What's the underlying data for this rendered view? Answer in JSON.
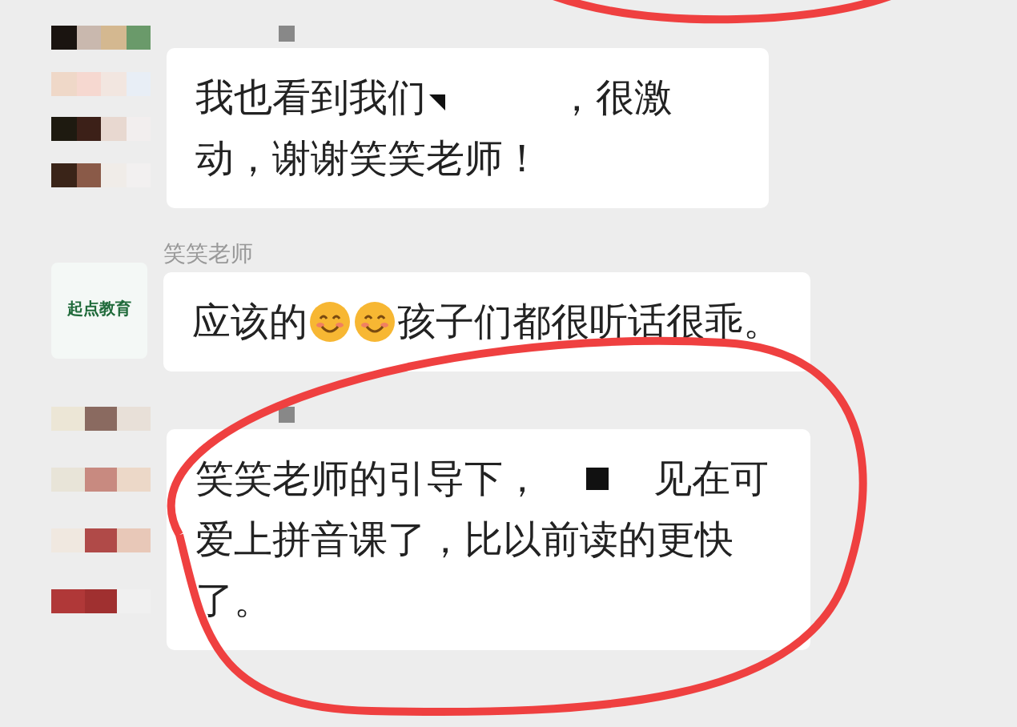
{
  "messages": [
    {
      "avatar": {
        "kind": "pixelated"
      },
      "name_redacted": true,
      "parts": [
        {
          "kind": "text",
          "text": "我也看到我们"
        },
        {
          "kind": "redaction"
        },
        {
          "kind": "text",
          "text": "，很激动，谢谢笑笑老师！"
        }
      ],
      "circled": false
    },
    {
      "avatar": {
        "kind": "logo",
        "text": "起点教育"
      },
      "name_redacted": false,
      "name": "笑笑老师",
      "parts": [
        {
          "kind": "text",
          "text": "应该的"
        },
        {
          "kind": "emoji"
        },
        {
          "kind": "emoji"
        },
        {
          "kind": "text",
          "text": "孩子们都很听话很乖。"
        }
      ],
      "circled": false
    },
    {
      "avatar": {
        "kind": "pixelated"
      },
      "name_redacted": true,
      "parts": [
        {
          "kind": "text",
          "text": "笑笑老师的引导下，"
        },
        {
          "kind": "redaction"
        },
        {
          "kind": "text",
          "text": "见在可爱上拼音课了，比以前读的更快了。"
        }
      ],
      "circled": true
    }
  ]
}
